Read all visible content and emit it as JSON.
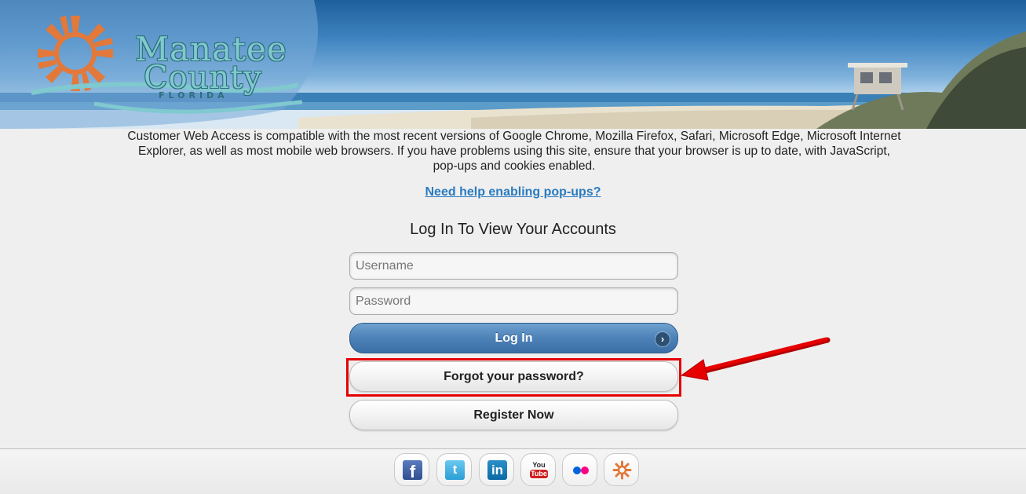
{
  "banner": {
    "logo_line1": "Manatee",
    "logo_line2": "County",
    "logo_line3": "FLORIDA"
  },
  "notice": {
    "text": "Customer Web Access is compatible with the most recent versions of Google Chrome, Mozilla Firefox, Safari, Microsoft Edge, Microsoft Internet Explorer, as well as most mobile web browsers. If you have problems using this site, ensure that your browser is up to date, with JavaScript, pop-ups and cookies enabled."
  },
  "help_link": {
    "label": "Need help enabling pop-ups?"
  },
  "login": {
    "title": "Log In To View Your Accounts",
    "username_placeholder": "Username",
    "password_placeholder": "Password",
    "login_label": "Log In",
    "login_icon": "chevron-right-icon",
    "forgot_label": "Forgot your password?",
    "register_label": "Register Now"
  },
  "social": {
    "items": [
      {
        "name": "facebook",
        "glyph": "f"
      },
      {
        "name": "twitter",
        "glyph": "t"
      },
      {
        "name": "linkedin",
        "glyph": "in"
      },
      {
        "name": "youtube",
        "glyph_top": "You",
        "glyph_bottom": "Tube"
      },
      {
        "name": "flickr",
        "glyph": ""
      },
      {
        "name": "manatee-county",
        "glyph": ""
      }
    ]
  },
  "colors": {
    "accent_blue": "#4d82b8",
    "link": "#2a7bc0",
    "annotation_red": "#e60000"
  }
}
